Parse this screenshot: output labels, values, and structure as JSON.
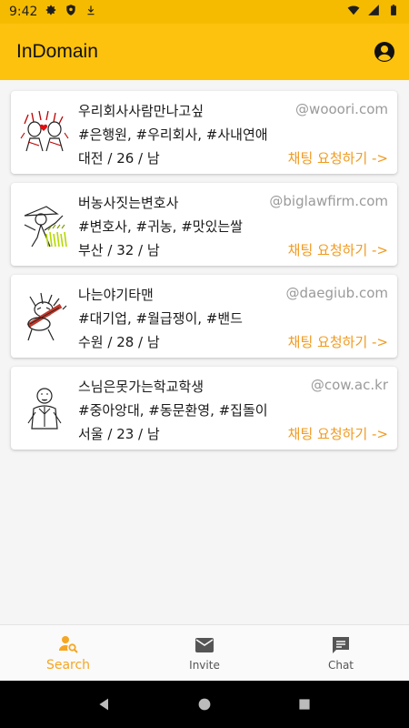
{
  "status_bar": {
    "time": "9:42"
  },
  "app_bar": {
    "title": "InDomain"
  },
  "cards": [
    {
      "nickname": "우리회사사람만나고싶",
      "domain": "@wooori.com",
      "tags": "#은행원, #우리회사, #사내연애",
      "info": "대전 / 26 / 남",
      "action": "채팅 요청하기 ->"
    },
    {
      "nickname": "버농사짓는변호사",
      "domain": "@biglawfirm.com",
      "tags": "#변호사, #귀농, #맛있는쌀",
      "info": "부산 / 32 / 남",
      "action": "채팅 요청하기 ->"
    },
    {
      "nickname": "나는야기타맨",
      "domain": "@daegiub.com",
      "tags": "#대기업, #월급쟁이, #밴드",
      "info": "수원 / 28 / 남",
      "action": "채팅 요청하기 ->"
    },
    {
      "nickname": "스님은못가는학교학생",
      "domain": "@cow.ac.kr",
      "tags": "#중아앙대, #동문환영, #집돌이",
      "info": "서울 / 23 / 남",
      "action": "채팅 요청하기 ->"
    }
  ],
  "bottom_nav": {
    "search": "Search",
    "invite": "Invite",
    "chat": "Chat"
  },
  "colors": {
    "accent": "#fdc20d",
    "status": "#f5bb00",
    "action": "#f19a1f",
    "active_tab": "#f5a623"
  }
}
